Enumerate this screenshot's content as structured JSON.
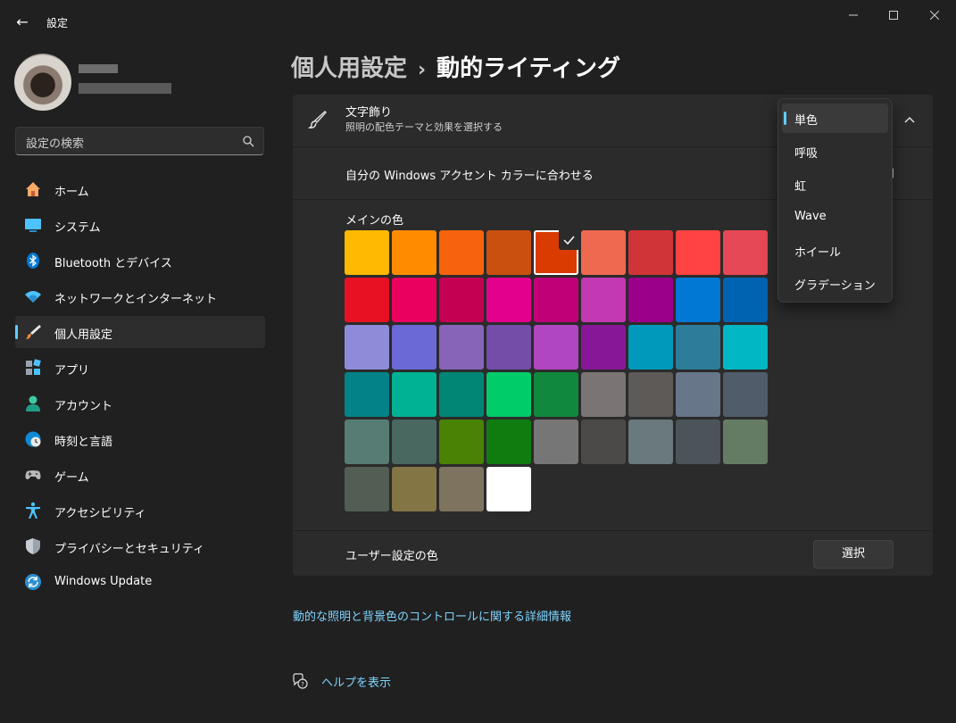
{
  "window": {
    "title": "設定",
    "back": "←",
    "minimize": "—",
    "maximize": "☐",
    "close": "✕"
  },
  "search": {
    "placeholder": "設定の検索"
  },
  "sidebar": {
    "items": [
      {
        "label": "ホーム",
        "icon": "home-icon"
      },
      {
        "label": "システム",
        "icon": "system-icon"
      },
      {
        "label": "Bluetooth とデバイス",
        "icon": "bluetooth-icon"
      },
      {
        "label": "ネットワークとインターネット",
        "icon": "wifi-icon"
      },
      {
        "label": "個人用設定",
        "icon": "brush-icon",
        "selected": true
      },
      {
        "label": "アプリ",
        "icon": "apps-icon"
      },
      {
        "label": "アカウント",
        "icon": "account-icon"
      },
      {
        "label": "時刻と言語",
        "icon": "globe-clock-icon"
      },
      {
        "label": "ゲーム",
        "icon": "gamepad-icon"
      },
      {
        "label": "アクセシビリティ",
        "icon": "accessibility-icon"
      },
      {
        "label": "プライバシーとセキュリティ",
        "icon": "shield-icon"
      },
      {
        "label": "Windows Update",
        "icon": "update-icon"
      }
    ]
  },
  "breadcrumb": {
    "parent": "個人用設定",
    "separator": "›",
    "current": "動的ライティング"
  },
  "effects": {
    "title": "文字飾り",
    "subtitle": "照明の配色テーマと効果を選択する",
    "accent_match_label": "自分の Windows アクセント カラーに合わせる",
    "main_color_label": "メインの色",
    "custom_color_label": "ユーザー設定の色",
    "select_button": "選択",
    "selected_swatch_index": 4,
    "swatches": [
      "#ffb900",
      "#ff8c00",
      "#f7630c",
      "#ca5010",
      "#da3b01",
      "#ef6950",
      "#d13438",
      "#ff4343",
      "#e74856",
      "#e81123",
      "#ea005e",
      "#c30052",
      "#e3008c",
      "#bf0077",
      "#c239b3",
      "#9a0089",
      "#0078d4",
      "#0063b1",
      "#8e8cd8",
      "#6b69d6",
      "#8764b8",
      "#744da9",
      "#b146c2",
      "#881798",
      "#0099bc",
      "#2d7d9a",
      "#00b7c3",
      "#038387",
      "#00b294",
      "#018574",
      "#00cc6a",
      "#10893e",
      "#7a7574",
      "#5d5a58",
      "#68768a",
      "#515c6b",
      "#567c73",
      "#486860",
      "#498205",
      "#107c10",
      "#767676",
      "#4c4a48",
      "#69797e",
      "#4a5459",
      "#647c64",
      "#525e54",
      "#847545",
      "#7e735f",
      "#ffffff"
    ]
  },
  "dropdown": {
    "options": [
      "単色",
      "呼吸",
      "虹",
      "Wave",
      "ホイール",
      "グラデーション"
    ],
    "selected": 0
  },
  "links": {
    "learn_more": "動的な照明と背景色のコントロールに関する詳細情報",
    "help": "ヘルプを表示"
  },
  "colors": {
    "accent": "#60cdff",
    "link": "#7fd4ff"
  }
}
